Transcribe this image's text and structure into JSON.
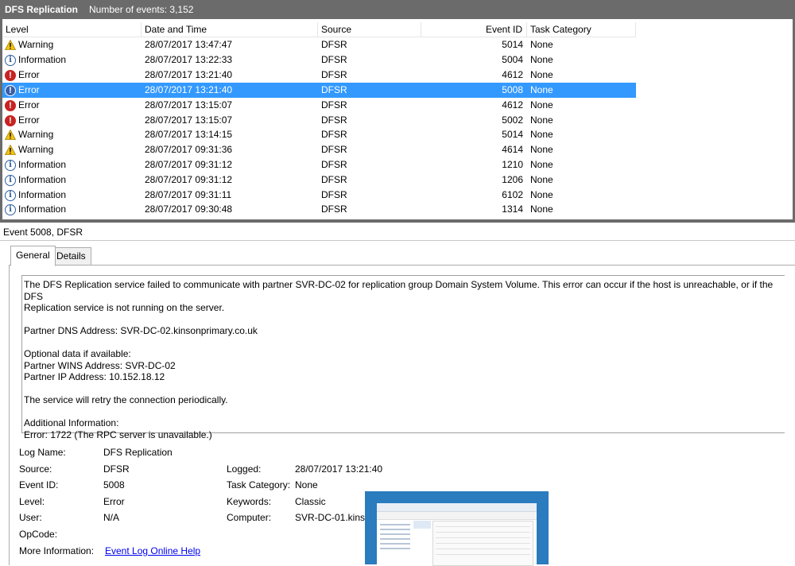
{
  "header": {
    "title": "DFS Replication",
    "count_label": "Number of events: 3,152"
  },
  "columns": {
    "level": "Level",
    "date": "Date and Time",
    "source": "Source",
    "event_id": "Event ID",
    "category": "Task Category"
  },
  "rows": [
    {
      "level": "Warning",
      "icon": "warning-icon",
      "date": "28/07/2017 13:47:47",
      "source": "DFSR",
      "event_id": "5014",
      "category": "None"
    },
    {
      "level": "Information",
      "icon": "info-icon",
      "date": "28/07/2017 13:22:33",
      "source": "DFSR",
      "event_id": "5004",
      "category": "None"
    },
    {
      "level": "Error",
      "icon": "error-icon",
      "date": "28/07/2017 13:21:40",
      "source": "DFSR",
      "event_id": "4612",
      "category": "None"
    },
    {
      "level": "Error",
      "icon": "error-icon",
      "date": "28/07/2017 13:21:40",
      "source": "DFSR",
      "event_id": "5008",
      "category": "None",
      "selected": true
    },
    {
      "level": "Error",
      "icon": "error-icon",
      "date": "28/07/2017 13:15:07",
      "source": "DFSR",
      "event_id": "4612",
      "category": "None"
    },
    {
      "level": "Error",
      "icon": "error-icon",
      "date": "28/07/2017 13:15:07",
      "source": "DFSR",
      "event_id": "5002",
      "category": "None"
    },
    {
      "level": "Warning",
      "icon": "warning-icon",
      "date": "28/07/2017 13:14:15",
      "source": "DFSR",
      "event_id": "5014",
      "category": "None"
    },
    {
      "level": "Warning",
      "icon": "warning-icon",
      "date": "28/07/2017 09:31:36",
      "source": "DFSR",
      "event_id": "4614",
      "category": "None"
    },
    {
      "level": "Information",
      "icon": "info-icon",
      "date": "28/07/2017 09:31:12",
      "source": "DFSR",
      "event_id": "1210",
      "category": "None"
    },
    {
      "level": "Information",
      "icon": "info-icon",
      "date": "28/07/2017 09:31:12",
      "source": "DFSR",
      "event_id": "1206",
      "category": "None"
    },
    {
      "level": "Information",
      "icon": "info-icon",
      "date": "28/07/2017 09:31:11",
      "source": "DFSR",
      "event_id": "6102",
      "category": "None"
    },
    {
      "level": "Information",
      "icon": "info-icon",
      "date": "28/07/2017 09:30:48",
      "source": "DFSR",
      "event_id": "1314",
      "category": "None"
    }
  ],
  "detail": {
    "title": "Event 5008, DFSR",
    "tabs": {
      "general": "General",
      "details": "Details"
    },
    "description": {
      "line1": "The DFS Replication service failed to communicate with partner SVR-DC-02 for replication group Domain System Volume. This error can occur if the host is unreachable, or if the DFS",
      "line2": "Replication service is not running on the server.",
      "line3": "Partner DNS Address: SVR-DC-02.kinsonprimary.co.uk",
      "line4": "Optional data if available:",
      "line5": "Partner WINS Address: SVR-DC-02",
      "line6": "Partner IP Address: 10.152.18.12",
      "line7": "The service will retry the connection periodically.",
      "line8": "Additional Information:",
      "line9": "Error: 1722 (The RPC server is unavailable.)"
    },
    "fields": {
      "log_name_label": "Log Name:",
      "log_name": "DFS Replication",
      "source_label": "Source:",
      "source": "DFSR",
      "logged_label": "Logged:",
      "logged": "28/07/2017 13:21:40",
      "event_id_label": "Event ID:",
      "event_id": "5008",
      "task_category_label": "Task Category:",
      "task_category": "None",
      "level_label": "Level:",
      "level": "Error",
      "keywords_label": "Keywords:",
      "keywords": "Classic",
      "user_label": "User:",
      "user": "N/A",
      "computer_label": "Computer:",
      "computer": "SVR-DC-01.kinso",
      "opcode_label": "OpCode:",
      "more_info_label": "More Information:",
      "more_info_link": "Event Log Online Help"
    }
  },
  "colors": {
    "header_bg": "#6b6b6b",
    "selection": "#3399ff",
    "error": "#c72323",
    "warning": "#f2c40f",
    "info": "#2f5f9e",
    "thumbnail_bg": "#2b7bbf"
  }
}
